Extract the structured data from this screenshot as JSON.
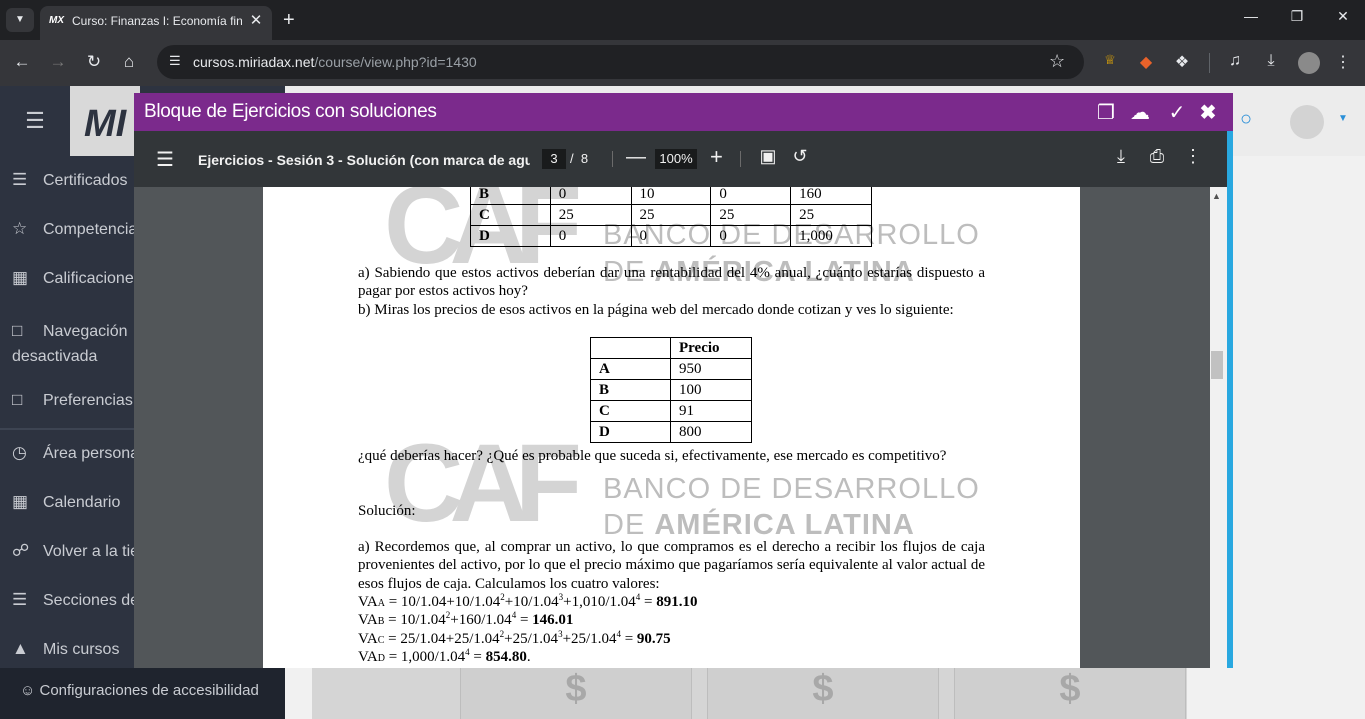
{
  "browser": {
    "tab_favicon": "MX",
    "tab_title": "Curso: Finanzas I: Economía fina",
    "url_domain": "cursos.miriadax.net",
    "url_path": "/course/view.php?id=1430"
  },
  "sidebar": {
    "items": [
      {
        "label": "Certificados",
        "icon": "layers-icon"
      },
      {
        "label": "Competencias",
        "icon": "star-icon"
      },
      {
        "label": "Calificaciones",
        "icon": "gradebook-icon"
      },
      {
        "label": "Navegación desactivada",
        "icon": "folder-icon"
      },
      {
        "label": "Preferencias",
        "icon": "folder-icon"
      },
      {
        "label": "Área personal",
        "icon": "dashboard-icon"
      },
      {
        "label": "Calendario",
        "icon": "calendar-icon"
      },
      {
        "label": "Volver a la tienda",
        "icon": "cart-icon"
      },
      {
        "label": "Secciones del curso",
        "icon": "list-icon"
      },
      {
        "label": "Mis cursos",
        "icon": "graduation-icon"
      }
    ],
    "accessibility_label": "Configuraciones de accesibilidad"
  },
  "modal": {
    "title": "Bloque de Ejercicios con soluciones"
  },
  "pdf": {
    "title": "Ejercicios - Sesión 3 - Solución (con marca de agu...",
    "current_page": "3",
    "page_separator": "/",
    "total_pages": "8",
    "zoom": "100%",
    "watermark": {
      "logo": "CAF",
      "line1": "BANCO DE DESARROLLO",
      "line2_prefix": "DE ",
      "line2_bold": "AMÉRICA LATINA"
    },
    "top_table": [
      [
        "B",
        "0",
        "10",
        "0",
        "160"
      ],
      [
        "C",
        "25",
        "25",
        "25",
        "25"
      ],
      [
        "D",
        "0",
        "0",
        "0",
        "1,000"
      ]
    ],
    "para_a": "a) Sabiendo que estos activos deberían dar una rentabilidad del 4% anual, ¿cuánto estarías dispuesto a pagar por estos activos hoy?",
    "para_b": "b) Miras los precios de esos activos en la página web del mercado donde cotizan y ves lo siguiente:",
    "price_table": {
      "header": "Precio",
      "rows": [
        [
          "A",
          "950"
        ],
        [
          "B",
          "100"
        ],
        [
          "C",
          "91"
        ],
        [
          "D",
          "800"
        ]
      ]
    },
    "question": "¿qué deberías hacer? ¿Qué es probable que suceda si, efectivamente, ese mercado es competitivo?",
    "solution_label": "Solución:",
    "solution_text": "a) Recordemos que, al comprar un activo, lo que compramos es el derecho a recibir los flujos de caja provenientes del activo, por lo que el precio máximo que pagaríamos sería equivalente al valor actual de esos flujos de caja. Calculamos los cuatro valores:",
    "equations": [
      {
        "sub": "A",
        "expr": " = 10/1.04+10/1.04",
        "rest": "+10/1.04",
        "rest2": "+1,010/1.04",
        "result": "891.10"
      },
      {
        "sub": "B",
        "expr": " = 10/1.04",
        "rest": "+160/1.04",
        "result": "146.01"
      },
      {
        "sub": "C",
        "expr": " = 25/1.04+25/1.04",
        "rest": "+25/1.04",
        "rest2": "+25/1.04",
        "result": "90.75"
      },
      {
        "sub": "D",
        "expr": " = 1,000/1.04",
        "result": "854.80"
      }
    ]
  },
  "colors": {
    "modal_header": "#7b2a8c",
    "pdf_toolbar": "#323639",
    "sidebar": "#2d3340",
    "accent": "#29a8e0"
  }
}
